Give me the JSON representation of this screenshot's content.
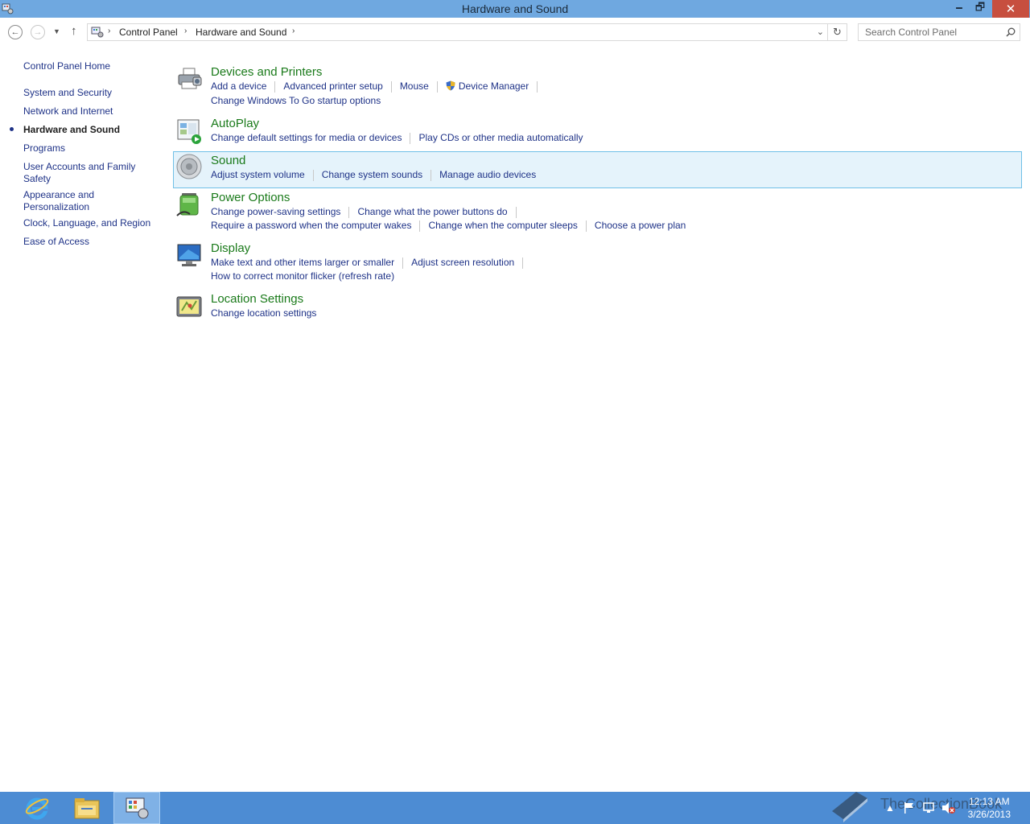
{
  "window": {
    "title": "Hardware and Sound",
    "minimize_glyph": "🗕",
    "restore_glyph": "🗗",
    "close_glyph": "✕"
  },
  "nav": {
    "back_glyph": "←",
    "forward_glyph": "→",
    "recent_glyph": "▼",
    "up_glyph": "↑",
    "breadcrumb": [
      "Control Panel",
      "Hardware and Sound"
    ],
    "crumb_sep": "›",
    "dropdown_glyph": "⌄",
    "refresh_glyph": "↻",
    "search_placeholder": "Search Control Panel"
  },
  "sidebar": {
    "home": "Control Panel Home",
    "items": [
      {
        "label": "System and Security"
      },
      {
        "label": "Network and Internet"
      },
      {
        "label": "Hardware and Sound",
        "current": true
      },
      {
        "label": "Programs"
      },
      {
        "label": "User Accounts and Family Safety"
      },
      {
        "label": "Appearance and Personalization"
      },
      {
        "label": "Clock, Language, and Region"
      },
      {
        "label": "Ease of Access"
      }
    ]
  },
  "categories": [
    {
      "title": "Devices and Printers",
      "icon": "printer-icon",
      "lines": [
        [
          "Add a device",
          "Advanced printer setup",
          "Mouse",
          "Device Manager"
        ],
        [
          "Change Windows To Go startup options"
        ]
      ]
    },
    {
      "title": "AutoPlay",
      "icon": "autoplay-icon",
      "lines": [
        [
          "Change default settings for media or devices",
          "Play CDs or other media automatically"
        ]
      ]
    },
    {
      "title": "Sound",
      "icon": "speaker-icon",
      "highlighted": true,
      "lines": [
        [
          "Adjust system volume",
          "Change system sounds",
          "Manage audio devices"
        ]
      ]
    },
    {
      "title": "Power Options",
      "icon": "battery-icon",
      "lines": [
        [
          "Change power-saving settings",
          "Change what the power buttons do"
        ],
        [
          "Require a password when the computer wakes",
          "Change when the computer sleeps",
          "Choose a power plan"
        ]
      ]
    },
    {
      "title": "Display",
      "icon": "monitor-icon",
      "lines": [
        [
          "Make text and other items larger or smaller",
          "Adjust screen resolution"
        ],
        [
          "How to correct monitor flicker (refresh rate)"
        ]
      ]
    },
    {
      "title": "Location Settings",
      "icon": "location-icon",
      "lines": [
        [
          "Change location settings"
        ]
      ]
    }
  ],
  "taskbar": {
    "apps": [
      "internet-explorer-icon",
      "file-explorer-icon",
      "control-panel-icon"
    ],
    "tray_arrow": "▲",
    "time": "12:13 AM",
    "date": "3/26/2013",
    "watermark": "TheCollectionBook"
  },
  "colors": {
    "titlebar": "#6fa8e0",
    "taskbar": "#4d8cd3",
    "link": "#1e3287",
    "category_title": "#1a7a1a",
    "highlight_bg": "#e5f3fb",
    "highlight_border": "#70c0e7"
  }
}
